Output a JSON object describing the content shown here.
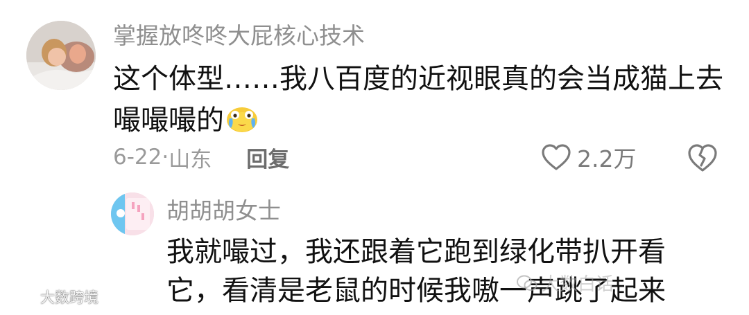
{
  "comment": {
    "username": "掌握放咚咚大屁核心技术",
    "text": "这个体型……我八百度的近视眼真的会当成猫上去嘬嘬嘬的",
    "emoji": "crying-laughing-emoji",
    "date": "6-22",
    "separator": "·",
    "location": "山东",
    "reply_label": "回复",
    "like_count": "2.2万"
  },
  "reply": {
    "username": "胡胡胡女士",
    "text": "我就嘬过，我还跟着它跑到绿化带扒开看它，看清是老鼠的时候我嗷一声跳了起来"
  },
  "watermarks": {
    "left": "大数跨境",
    "right": "大数白话"
  },
  "colors": {
    "meta_gray": "#9a9a9a",
    "text_black": "#111111",
    "username_gray": "#8f8f8f"
  }
}
